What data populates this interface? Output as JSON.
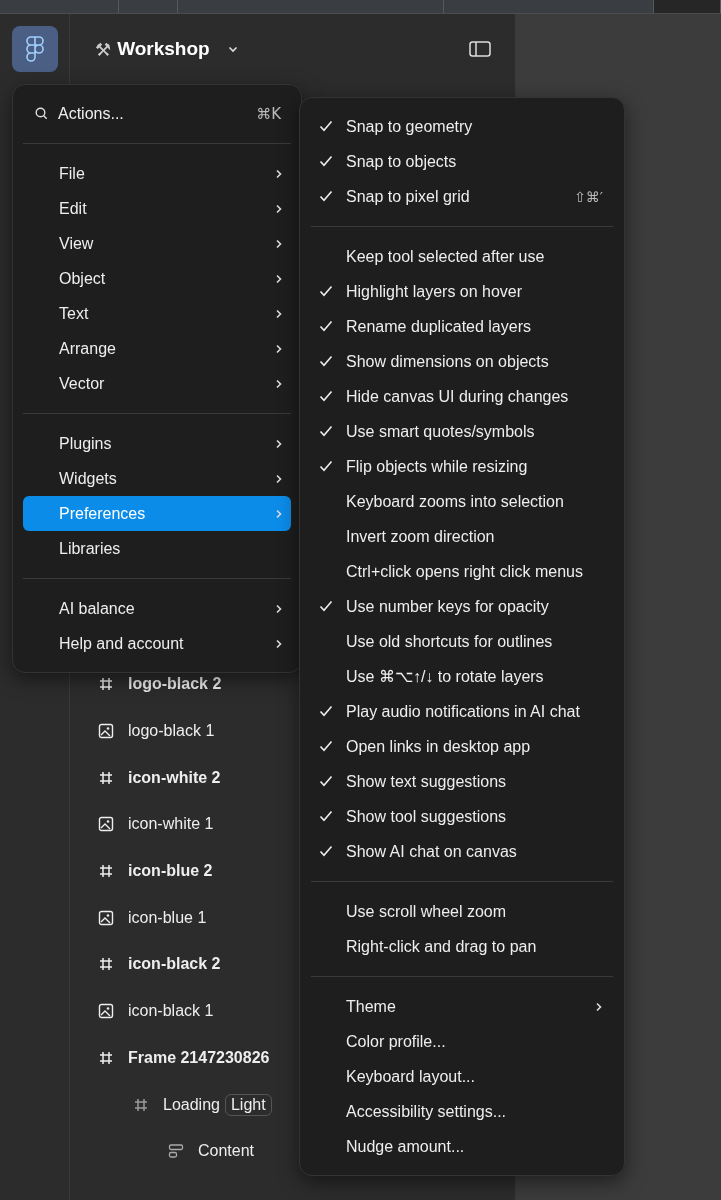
{
  "file_header": {
    "emoji": "⚒",
    "title": "Workshop"
  },
  "layers": [
    {
      "name": "logo-black 2",
      "kind": "frame"
    },
    {
      "name": "logo-black 1",
      "kind": "image"
    },
    {
      "name": "icon-white 2",
      "kind": "frame"
    },
    {
      "name": "icon-white 1",
      "kind": "image"
    },
    {
      "name": "icon-blue 2",
      "kind": "frame"
    },
    {
      "name": "icon-blue 1",
      "kind": "image"
    },
    {
      "name": "icon-black 2",
      "kind": "frame"
    },
    {
      "name": "icon-black 1",
      "kind": "image"
    },
    {
      "name": "Frame 2147230826",
      "kind": "frame",
      "children": [
        {
          "name": "Loading",
          "kind": "frame",
          "badge": "Light",
          "children": [
            {
              "name": "Content",
              "kind": "autolayout"
            }
          ]
        }
      ]
    }
  ],
  "main_menu": {
    "search": {
      "label": "Actions...",
      "shortcut": "⌘K"
    },
    "sections": [
      [
        {
          "label": "File",
          "submenu": true,
          "selected": false
        },
        {
          "label": "Edit",
          "submenu": true,
          "selected": false
        },
        {
          "label": "View",
          "submenu": true,
          "selected": false
        },
        {
          "label": "Object",
          "submenu": true,
          "selected": false
        },
        {
          "label": "Text",
          "submenu": true,
          "selected": false
        },
        {
          "label": "Arrange",
          "submenu": true,
          "selected": false
        },
        {
          "label": "Vector",
          "submenu": true,
          "selected": false
        }
      ],
      [
        {
          "label": "Plugins",
          "submenu": true,
          "selected": false
        },
        {
          "label": "Widgets",
          "submenu": true,
          "selected": false
        },
        {
          "label": "Preferences",
          "submenu": true,
          "selected": true
        },
        {
          "label": "Libraries",
          "submenu": false,
          "selected": false
        }
      ],
      [
        {
          "label": "AI balance",
          "submenu": true,
          "selected": false
        },
        {
          "label": "Help and account",
          "submenu": true,
          "selected": false
        }
      ]
    ]
  },
  "preferences_menu": {
    "sections": [
      [
        {
          "label": "Snap to geometry",
          "checked": true
        },
        {
          "label": "Snap to objects",
          "checked": true
        },
        {
          "label": "Snap to pixel grid",
          "checked": true,
          "shortcut": "⇧⌘′"
        }
      ],
      [
        {
          "label": "Keep tool selected after use",
          "checked": false
        },
        {
          "label": "Highlight layers on hover",
          "checked": true
        },
        {
          "label": "Rename duplicated layers",
          "checked": true
        },
        {
          "label": "Show dimensions on objects",
          "checked": true
        },
        {
          "label": "Hide canvas UI during changes",
          "checked": true
        },
        {
          "label": "Use smart quotes/symbols",
          "checked": true
        },
        {
          "label": "Flip objects while resizing",
          "checked": true
        },
        {
          "label": "Keyboard zooms into selection",
          "checked": false
        },
        {
          "label": "Invert zoom direction",
          "checked": false
        },
        {
          "label": "Ctrl+click opens right click menus",
          "checked": false
        },
        {
          "label": "Use number keys for opacity",
          "checked": true
        },
        {
          "label": "Use old shortcuts for outlines",
          "checked": false
        },
        {
          "label": "Use ⌘⌥↑/↓ to rotate layers",
          "checked": false
        },
        {
          "label": "Play audio notifications in AI chat",
          "checked": true
        },
        {
          "label": "Open links in desktop app",
          "checked": true
        },
        {
          "label": "Show text suggestions",
          "checked": true
        },
        {
          "label": "Show tool suggestions",
          "checked": true
        },
        {
          "label": "Show AI chat on canvas",
          "checked": true
        }
      ],
      [
        {
          "label": "Use scroll wheel zoom",
          "checked": false
        },
        {
          "label": "Right-click and drag to pan",
          "checked": false
        }
      ],
      [
        {
          "label": "Theme",
          "checked": false,
          "submenu": true
        },
        {
          "label": "Color profile...",
          "checked": false
        },
        {
          "label": "Keyboard layout...",
          "checked": false
        },
        {
          "label": "Accessibility settings...",
          "checked": false
        },
        {
          "label": "Nudge amount...",
          "checked": false
        }
      ]
    ]
  }
}
